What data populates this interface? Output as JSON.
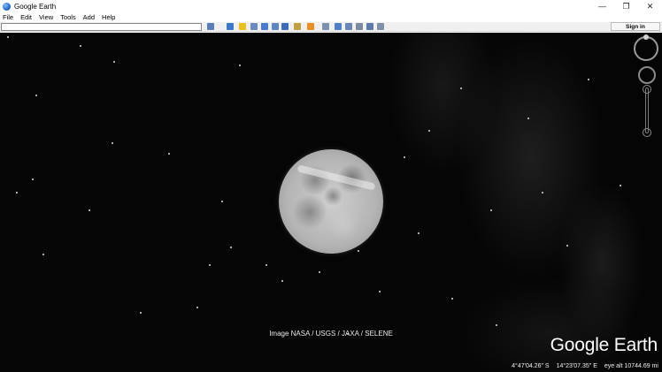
{
  "window": {
    "title": "Google Earth",
    "controls": {
      "minimize": "—",
      "restore": "❐",
      "close": "✕"
    }
  },
  "menu": {
    "items": [
      "File",
      "Edit",
      "View",
      "Tools",
      "Add",
      "Help"
    ]
  },
  "toolbar": {
    "search_value": "",
    "buttons": [
      {
        "name": "search-icon",
        "color": "#5a7fb8"
      },
      {
        "name": "sidebar-icon",
        "color": "#3c78c8"
      },
      {
        "name": "placemark-icon",
        "color": "#e8c020"
      },
      {
        "name": "polygon-icon",
        "color": "#6c8cc0"
      },
      {
        "name": "path-icon",
        "color": "#4a7ad0"
      },
      {
        "name": "overlay-icon",
        "color": "#5e86c4"
      },
      {
        "name": "tour-icon",
        "color": "#3c6cb8"
      },
      {
        "name": "history-icon",
        "color": "#c0a040"
      },
      {
        "name": "sun-icon",
        "color": "#e89020"
      },
      {
        "name": "planets-icon",
        "color": "#7a90b0"
      },
      {
        "name": "ruler-icon",
        "color": "#5080c8"
      },
      {
        "name": "email-icon",
        "color": "#6a86b6"
      },
      {
        "name": "print-icon",
        "color": "#7a8aa0"
      },
      {
        "name": "save-image-icon",
        "color": "#5c7aa8"
      },
      {
        "name": "maps-icon",
        "color": "#8090a8"
      }
    ],
    "signin_label": "Sign in"
  },
  "viewport": {
    "credit": "Image NASA / USGS / JAXA / SELENE",
    "logo": "Google Earth",
    "status": {
      "latitude": "4°47'04.26\" S",
      "longitude": "14°23'07.35\" E",
      "eye_alt": "eye alt 10744.69 mi"
    }
  }
}
